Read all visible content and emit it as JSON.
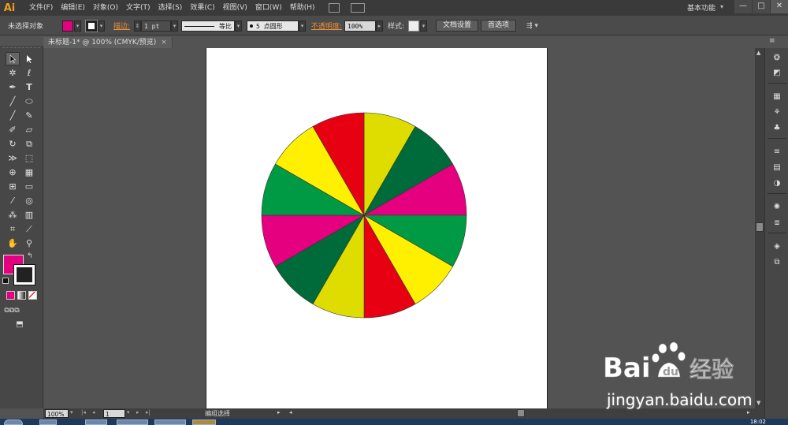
{
  "app": {
    "logo": "Ai",
    "menu": [
      "文件(F)",
      "编辑(E)",
      "对象(O)",
      "文字(T)",
      "选择(S)",
      "效果(C)",
      "视图(V)",
      "窗口(W)",
      "帮助(H)"
    ],
    "workspace": "基本功能",
    "window_buttons": [
      "—",
      "□",
      "✕"
    ]
  },
  "control_bar": {
    "selection_label": "未选择对象",
    "stroke_label": "描边:",
    "stroke_weight": "1 pt",
    "stroke_profile": "等比",
    "brush": "5 点圆形",
    "opacity_label": "不透明度:",
    "opacity_value": "100%",
    "style_label": "样式:",
    "doc_setup_button": "文档设置",
    "preferences_button": "首选项",
    "fill_color": "#e4007f"
  },
  "document_tab": {
    "title": "未标题-1* @ 100% (CMYK/预览)",
    "close": "×"
  },
  "toolbar": {
    "fill_color": "#e4007f",
    "stroke_color": "#222222"
  },
  "chart_data": {
    "type": "pie",
    "title": "",
    "slices": [
      {
        "value": 1,
        "color": "#dfdc00"
      },
      {
        "value": 1,
        "color": "#006b3a"
      },
      {
        "value": 1,
        "color": "#e4007f"
      },
      {
        "value": 1,
        "color": "#009944"
      },
      {
        "value": 1,
        "color": "#fff000"
      },
      {
        "value": 1,
        "color": "#e60012"
      },
      {
        "value": 1,
        "color": "#dfdc00"
      },
      {
        "value": 1,
        "color": "#006b3a"
      },
      {
        "value": 1,
        "color": "#e4007f"
      },
      {
        "value": 1,
        "color": "#009944"
      },
      {
        "value": 1,
        "color": "#fff000"
      },
      {
        "value": 1,
        "color": "#e60012"
      }
    ]
  },
  "status_bar": {
    "zoom": "100%",
    "page": "1",
    "tool_status": "编组选择"
  },
  "watermark": {
    "logo_text": "Bai",
    "logo_text2": "经验",
    "url": "jingyan.baidu.com"
  },
  "clock": "18:02"
}
